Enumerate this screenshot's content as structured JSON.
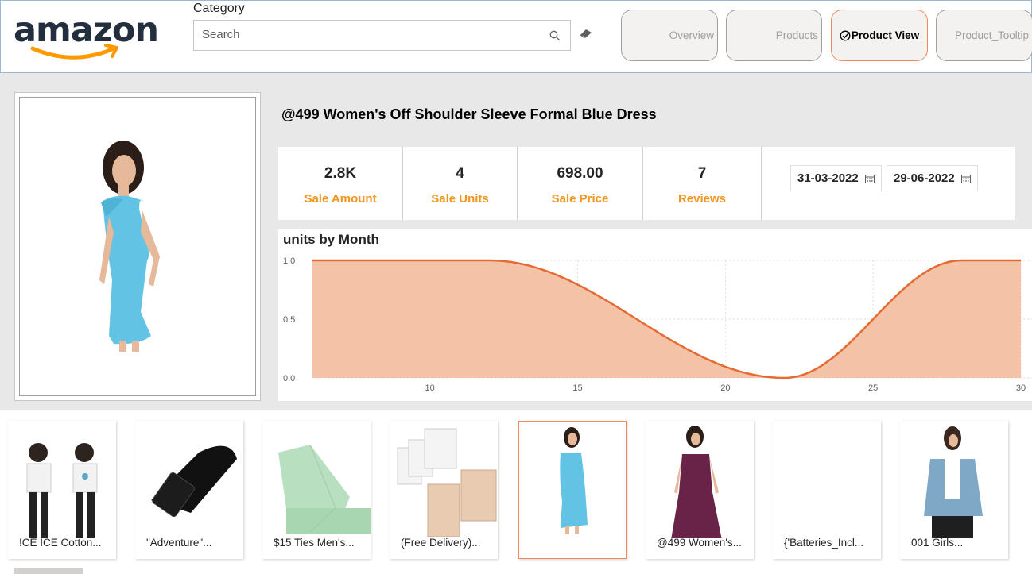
{
  "brand": {
    "logo_text": "amazon",
    "accent": "#ff9900",
    "dark": "#232f3e"
  },
  "slicer": {
    "label": "Category",
    "placeholder": "Search"
  },
  "nav": {
    "overview": "Overview",
    "products": "Products",
    "product_view": "Product View",
    "product_tooltip": "Product_Tooltip",
    "active": "product_view",
    "active_border": "#f08a5d"
  },
  "product": {
    "title": "@499 Women's Off Shoulder Sleeve Formal Blue Dress"
  },
  "kpis": [
    {
      "value": "2.8K",
      "label": "Sale Amount"
    },
    {
      "value": "4",
      "label": "Sale Units"
    },
    {
      "value": "698.00",
      "label": "Sale Price"
    },
    {
      "value": "7",
      "label": "Reviews"
    }
  ],
  "kpi_label_color": "#f0961e",
  "dates": {
    "start": "31-03-2022",
    "end": "29-06-2022"
  },
  "chart": {
    "title": "units by Month"
  },
  "chart_data": {
    "type": "area",
    "title": "units by Month",
    "x": [
      6,
      12,
      22,
      28,
      30
    ],
    "values": [
      1.0,
      1.0,
      0.0,
      1.0,
      1.0
    ],
    "xticks": [
      10,
      15,
      20,
      25,
      30
    ],
    "yticks": [
      "0.0",
      "0.5",
      "1.0"
    ],
    "xlim": [
      6,
      30
    ],
    "ylim": [
      0,
      1
    ],
    "grid": true,
    "line_color": "#e46c34",
    "fill_color": "#f4c2a7"
  },
  "gallery": [
    {
      "label": "!CE ICE Cotton..."
    },
    {
      "label": "\"Adventure\"..."
    },
    {
      "label": "$15 Ties Men's..."
    },
    {
      "label": "(Free Delivery)..."
    },
    {
      "label": "",
      "selected": true
    },
    {
      "label": "@499 Women's..."
    },
    {
      "label": "{'Batteries_Incl..."
    },
    {
      "label": "001 Girls..."
    }
  ]
}
